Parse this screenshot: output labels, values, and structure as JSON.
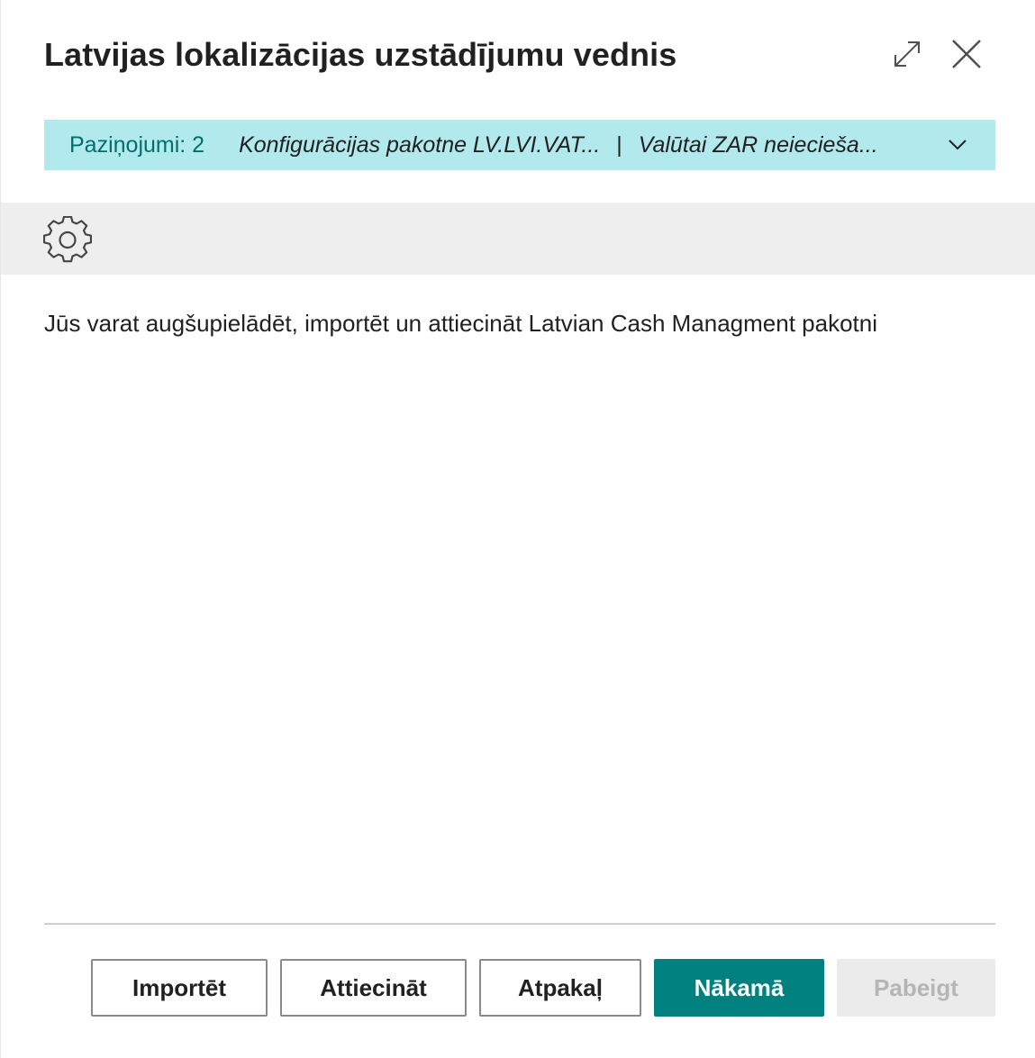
{
  "dialog": {
    "title": "Latvijas lokalizācijas uzstādījumu vednis",
    "expand_icon": "expand-diagonal-icon",
    "close_icon": "close-icon"
  },
  "notifications": {
    "count_label": "Paziņojumi: 2",
    "message_1": "Konfigurācijas pakotne LV.LVI.VAT...",
    "separator": "|",
    "message_2": "Valūtai ZAR neieciešа...",
    "expand_icon": "chevron-down-icon",
    "background_color": "#b2e9ec",
    "count_color": "#00706e"
  },
  "action_bar": {
    "icon": "gear-icon"
  },
  "content": {
    "instruction": "Jūs varat augšupielādēt, importēt un attiecināt Latvian Cash Managment pakotni"
  },
  "footer": {
    "import_label": "Importēt",
    "apply_label": "Attiecināt",
    "back_label": "Atpakaļ",
    "next_label": "Nākamā",
    "finish_label": "Pabeigt",
    "primary_color": "#00807e"
  }
}
